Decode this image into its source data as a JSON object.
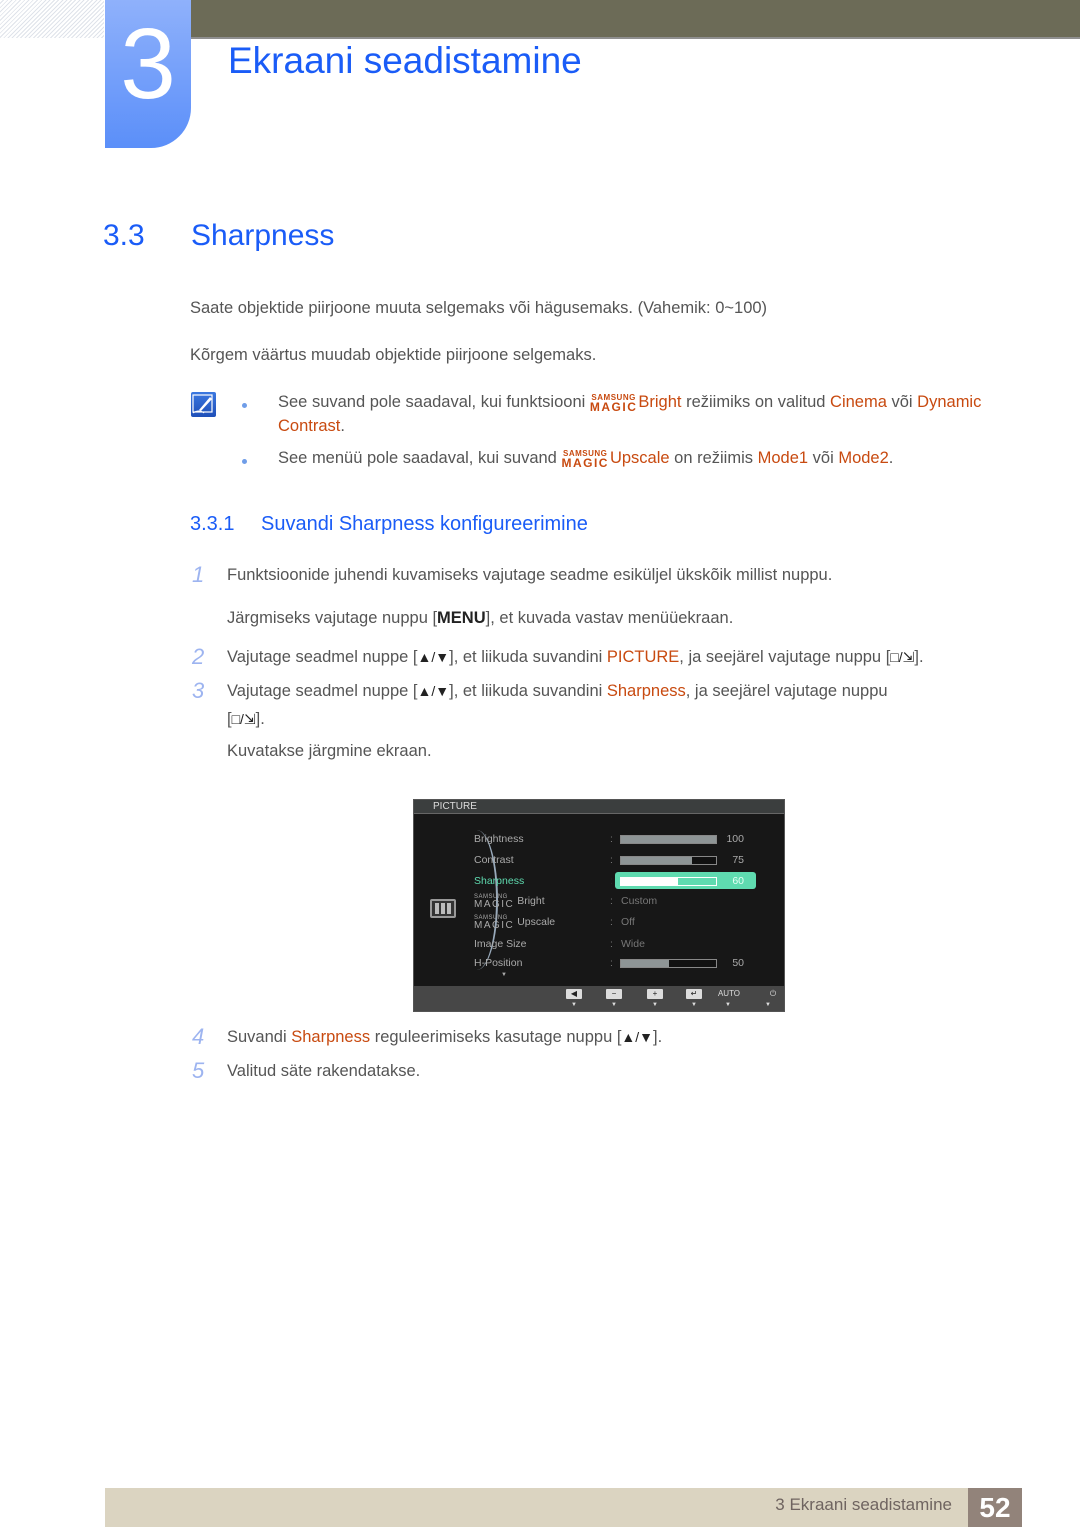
{
  "header": {
    "chapter_number": "3",
    "chapter_title": "Ekraani seadistamine"
  },
  "section": {
    "number": "3.3",
    "title": "Sharpness"
  },
  "intro": {
    "p1": "Saate objektide piirjoone muuta selgemaks või hägusemaks. (Vahemik: 0~100)",
    "p2": "Kõrgem väärtus muudab objektide piirjoone selgemaks."
  },
  "notes": {
    "icon": "note-pencil-icon",
    "note1": {
      "t1": "See suvand pole saadaval, kui funktsiooni ",
      "magic_top": "SAMSUNG",
      "magic_bottom": "MAGIC",
      "feature": "Bright",
      "t2": " režiimiks on valitud ",
      "opt1": "Cinema",
      "t3": " või ",
      "opt2a": "Dynamic",
      "opt2b": "Contrast",
      "t4": "."
    },
    "note2": {
      "t1": "See menüü pole saadaval, kui suvand ",
      "magic_top": "SAMSUNG",
      "magic_bottom": "MAGIC",
      "feature": "Upscale",
      "t2": " on režiimis ",
      "opt1": "Mode1",
      "t3": " või ",
      "opt2": "Mode2",
      "t4": "."
    }
  },
  "subsection": {
    "number": "3.3.1",
    "title": "Suvandi Sharpness konfigureerimine"
  },
  "steps": [
    {
      "num": "1",
      "line1": "Funktsioonide juhendi kuvamiseks vajutage seadme esiküljel ükskõik millist nuppu.",
      "line2_a": "Järgmiseks vajutage nuppu [",
      "line2_key": "MENU",
      "line2_b": "], et kuvada vastav menüüekraan."
    },
    {
      "num": "2",
      "a": "Vajutage seadmel nuppe [",
      "keys": "▲/▼",
      "b": "], et liikuda suvandini ",
      "hl": "PICTURE",
      "c": ", ja seejärel vajutage nuppu [",
      "keys2": "□/⇲",
      "d": "]."
    },
    {
      "num": "3",
      "a": "Vajutage seadmel nuppe [",
      "keys": "▲/▼",
      "b": "], et liikuda suvandini ",
      "hl": "Sharpness",
      "c": ", ja seejärel vajutage nuppu",
      "line2_a": "[",
      "keys2": "□/⇲",
      "line2_b": "].",
      "line3": "Kuvatakse järgmine ekraan."
    },
    {
      "num": "4",
      "a": "Suvandi ",
      "hl": "Sharpness",
      "b": " reguleerimiseks kasutage nuppu [",
      "keys": "▲/▼",
      "c": "]."
    },
    {
      "num": "5",
      "a": "Valitud säte rakendatakse."
    }
  ],
  "osd": {
    "title": "PICTURE",
    "menu_icon": "picture-menu-icon",
    "rows": [
      {
        "label": "Brightness",
        "type": "bar",
        "value": 100,
        "display": "100"
      },
      {
        "label": "Contrast",
        "type": "bar",
        "value": 75,
        "display": "75"
      },
      {
        "label": "Sharpness",
        "type": "bar",
        "value": 60,
        "display": "60",
        "selected": true
      },
      {
        "label_top": "SAMSUNG",
        "label_magic": "MAGIC",
        "label": "Bright",
        "type": "text",
        "display": "Custom"
      },
      {
        "label_top": "SAMSUNG",
        "label_magic": "MAGIC",
        "label": "Upscale",
        "type": "text",
        "display": "Off"
      },
      {
        "label": "Image Size",
        "type": "text",
        "display": "Wide"
      },
      {
        "label": "H-Position",
        "type": "bar",
        "value": 50,
        "display": "50"
      }
    ],
    "more_arrow": "▼",
    "buttons": [
      {
        "icon": "left-icon",
        "glyph": "◀"
      },
      {
        "icon": "minus-icon",
        "glyph": "−"
      },
      {
        "icon": "plus-icon",
        "glyph": "+"
      },
      {
        "icon": "enter-icon",
        "glyph": "↵"
      },
      {
        "icon": "auto-icon",
        "glyph": "AUTO"
      },
      {
        "icon": "power-icon",
        "glyph": "⏻"
      }
    ]
  },
  "footer": {
    "text": "3 Ekraani seadistamine",
    "page": "52"
  },
  "colors": {
    "heading_blue": "#1a5cf7",
    "highlight_orange": "#c84a10",
    "osd_selected": "#5fdbb0",
    "header_bar": "#6c6b57",
    "footer_bar": "#dbd4c1",
    "footer_page": "#92837a"
  }
}
